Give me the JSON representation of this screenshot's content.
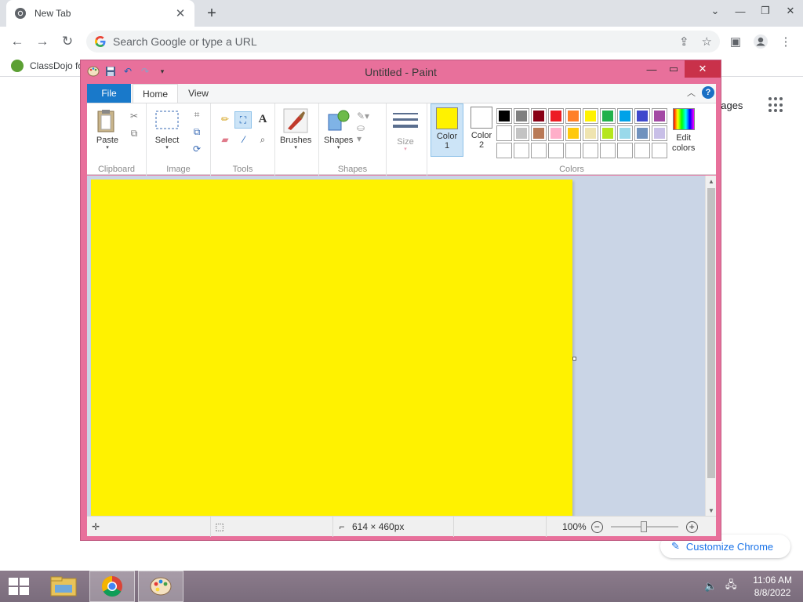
{
  "browser": {
    "tab_title": "New Tab",
    "new_tab_icon": "plus-icon",
    "omnibox_placeholder": "Search Google or type a URL",
    "bookmark_label": "ClassDojo fo",
    "ntp_images_label": "nages",
    "customize_label": "Customize Chrome"
  },
  "paint": {
    "title": "Untitled - Paint",
    "tabs": {
      "file": "File",
      "home": "Home",
      "view": "View"
    },
    "groups": {
      "clipboard": "Clipboard",
      "image": "Image",
      "tools": "Tools",
      "shapes": "Shapes",
      "colors": "Colors"
    },
    "buttons": {
      "paste": "Paste",
      "select": "Select",
      "brushes": "Brushes",
      "shapes": "Shapes",
      "size": "Size",
      "color1_line1": "Color",
      "color1_line2": "1",
      "color2_line1": "Color",
      "color2_line2": "2",
      "edit_colors_line1": "Edit",
      "edit_colors_line2": "colors"
    },
    "color1": "#fff200",
    "color2": "#ffffff",
    "palette_rows": [
      [
        "#000000",
        "#7f7f7f",
        "#880015",
        "#ed1c24",
        "#ff7f27",
        "#fff200",
        "#22b14c",
        "#00a2e8",
        "#3f48cc",
        "#a349a4"
      ],
      [
        "#ffffff",
        "#c3c3c3",
        "#b97a57",
        "#ffaec9",
        "#ffc90e",
        "#efe4b0",
        "#b5e61d",
        "#99d9ea",
        "#7092be",
        "#c8bfe7"
      ],
      [
        "#ffffff",
        "#ffffff",
        "#ffffff",
        "#ffffff",
        "#ffffff",
        "#ffffff",
        "#ffffff",
        "#ffffff",
        "#ffffff",
        "#ffffff"
      ]
    ],
    "canvas_fill": "#fff200",
    "status": {
      "dimensions": "614 × 460px",
      "zoom": "100%"
    }
  },
  "taskbar": {
    "time": "11:06 AM",
    "date": "8/8/2022"
  }
}
